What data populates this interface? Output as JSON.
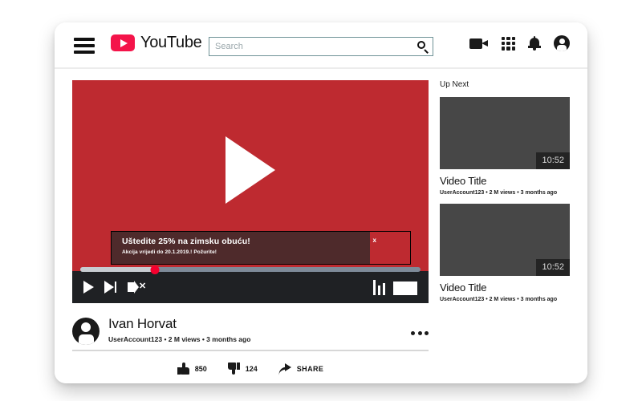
{
  "header": {
    "menu_icon": "hamburger-icon",
    "brand": "YouTube",
    "brand_logo_color": "#f4144a",
    "search": {
      "placeholder": "Search",
      "value": "",
      "icon": "search-icon",
      "border_color": "#6f9397"
    },
    "icons": [
      {
        "name": "video-camera-icon",
        "label": "Create"
      },
      {
        "name": "apps-grid-icon",
        "label": "YouTube apps"
      },
      {
        "name": "bell-icon",
        "label": "Notifications"
      },
      {
        "name": "account-avatar-icon",
        "label": "Account"
      }
    ]
  },
  "player": {
    "background_color": "#be2a30",
    "play_button": "play-triangle-icon",
    "progress_percent": 22,
    "scrubber_color": "#f5002e",
    "ad": {
      "title": "Uštedite 25% na zimsku obuću!",
      "subtitle": "Akcija vrijedi do 20.1.2019.! Požurite!",
      "close_label": "x",
      "panel_color": "#4e2a2b"
    },
    "controls": {
      "play": "play-icon",
      "next": "next-video-icon",
      "mute": "volume-muted-icon",
      "quality": "equalizer-icon",
      "fullscreen": "fullscreen-icon"
    }
  },
  "video_info": {
    "channel_name": "Ivan Horvat",
    "meta": "UserAccount123 • 2 M views • 3 months ago",
    "more_options": "more-options-icon"
  },
  "actions": {
    "like": {
      "icon": "thumbs-up-icon",
      "count": "850"
    },
    "dislike": {
      "icon": "thumbs-down-icon",
      "count": "124"
    },
    "share": {
      "icon": "share-icon",
      "label": "SHARE"
    }
  },
  "sidebar": {
    "heading": "Up Next",
    "items": [
      {
        "title": "Video Title",
        "meta": "UserAccount123 • 2 M views • 3 months ago",
        "duration": "10:52"
      },
      {
        "title": "Video Title",
        "meta": "UserAccount123 • 2 M views • 3 months ago",
        "duration": "10:52"
      }
    ]
  }
}
